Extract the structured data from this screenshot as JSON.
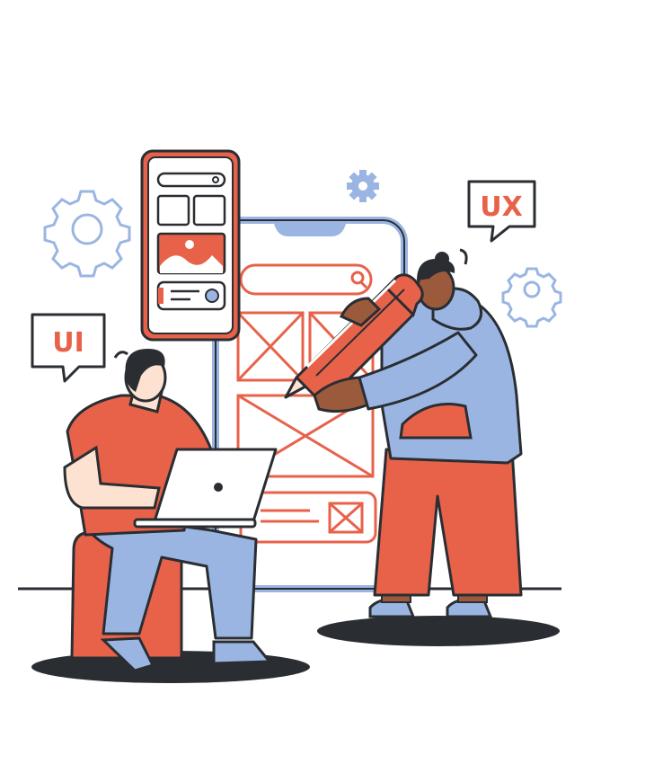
{
  "bubbles": {
    "ui": "UI",
    "ux": "UX"
  },
  "palette": {
    "red": "#e8624a",
    "blue": "#9bb5e3",
    "dark": "#2a2e33",
    "skin_light": "#fde2d2",
    "skin_dark": "#9c5a3c",
    "white": "#ffffff"
  }
}
